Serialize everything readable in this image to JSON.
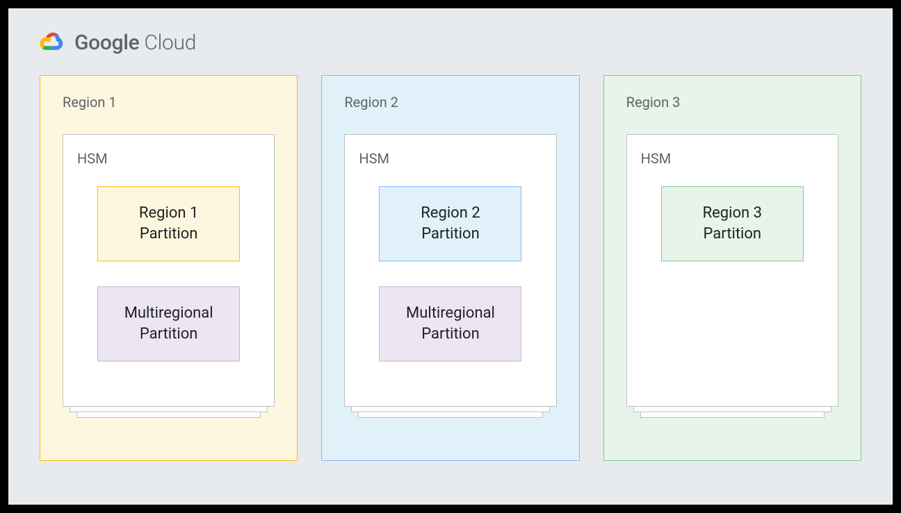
{
  "brand": {
    "name_bold": "Google",
    "name_light": " Cloud"
  },
  "regions": [
    {
      "label": "Region 1",
      "hsm_label": "HSM",
      "partitions": [
        {
          "line1": "Region 1",
          "line2": "Partition",
          "style": "part-yellow"
        },
        {
          "line1": "Multiregional",
          "line2": "Partition",
          "style": "part-purple"
        }
      ],
      "card_style": "region-1"
    },
    {
      "label": "Region 2",
      "hsm_label": "HSM",
      "partitions": [
        {
          "line1": "Region 2",
          "line2": "Partition",
          "style": "part-blue"
        },
        {
          "line1": "Multiregional",
          "line2": "Partition",
          "style": "part-purple"
        }
      ],
      "card_style": "region-2"
    },
    {
      "label": "Region 3",
      "hsm_label": "HSM",
      "partitions": [
        {
          "line1": "Region 3",
          "line2": "Partition",
          "style": "part-green"
        }
      ],
      "card_style": "region-3"
    }
  ]
}
